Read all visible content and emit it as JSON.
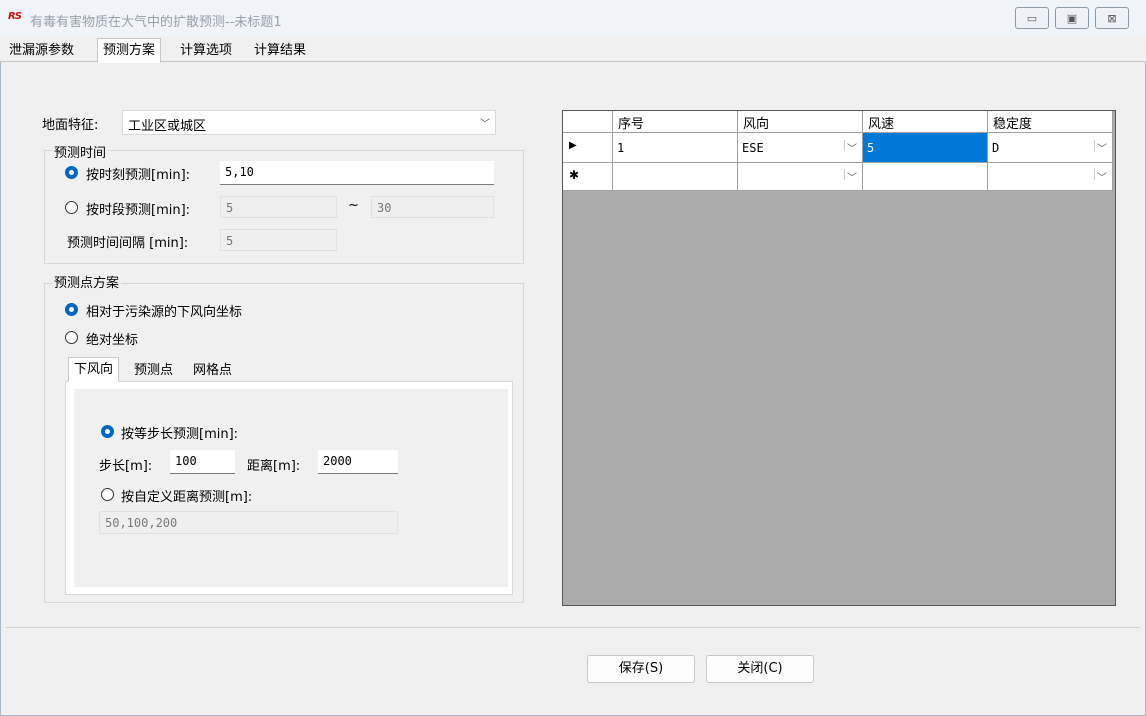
{
  "window": {
    "logo_text": "RS",
    "title": "有毒有害物质在大气中的扩散预测--未标题1",
    "min_icon": "minimize-icon",
    "max_icon": "maximize-icon",
    "close_icon": "close-icon"
  },
  "tabs": [
    "泄漏源参数",
    "预测方案",
    "计算选项",
    "计算结果"
  ],
  "active_tab": "预测方案",
  "ground": {
    "label": "地面特征:",
    "value": "工业区或城区"
  },
  "predict_time": {
    "title": "预测时间",
    "by_moment_label": "按时刻预测[min]:",
    "by_moment_value": "5,10",
    "by_period_label": "按时段预测[min]:",
    "period_from": "5",
    "tilde": "~",
    "period_to": "30",
    "interval_label": "预测时间间隔 [min]:",
    "interval_value": "5"
  },
  "predict_points": {
    "title": "预测点方案",
    "relative_label": "相对于污染源的下风向坐标",
    "absolute_label": "绝对坐标",
    "subtabs": [
      "下风向",
      "预测点",
      "网格点"
    ],
    "equal_step_label": "按等步长预测[min]:",
    "step_label": "步长[m]:",
    "step_value": "100",
    "distance_label": "距离[m]:",
    "distance_value": "2000",
    "custom_label": "按自定义距离预测[m]:",
    "custom_value": "50,100,200"
  },
  "grid": {
    "columns": [
      "序号",
      "风向",
      "风速",
      "稳定度"
    ],
    "rows": [
      {
        "indicator": "▶",
        "seq": "1",
        "dir": "ESE",
        "speed": "5",
        "stab": "D"
      },
      {
        "indicator": "✱",
        "seq": "",
        "dir": "",
        "speed": "",
        "stab": ""
      }
    ]
  },
  "buttons": {
    "save": "保存(S)",
    "close": "关闭(C)"
  }
}
